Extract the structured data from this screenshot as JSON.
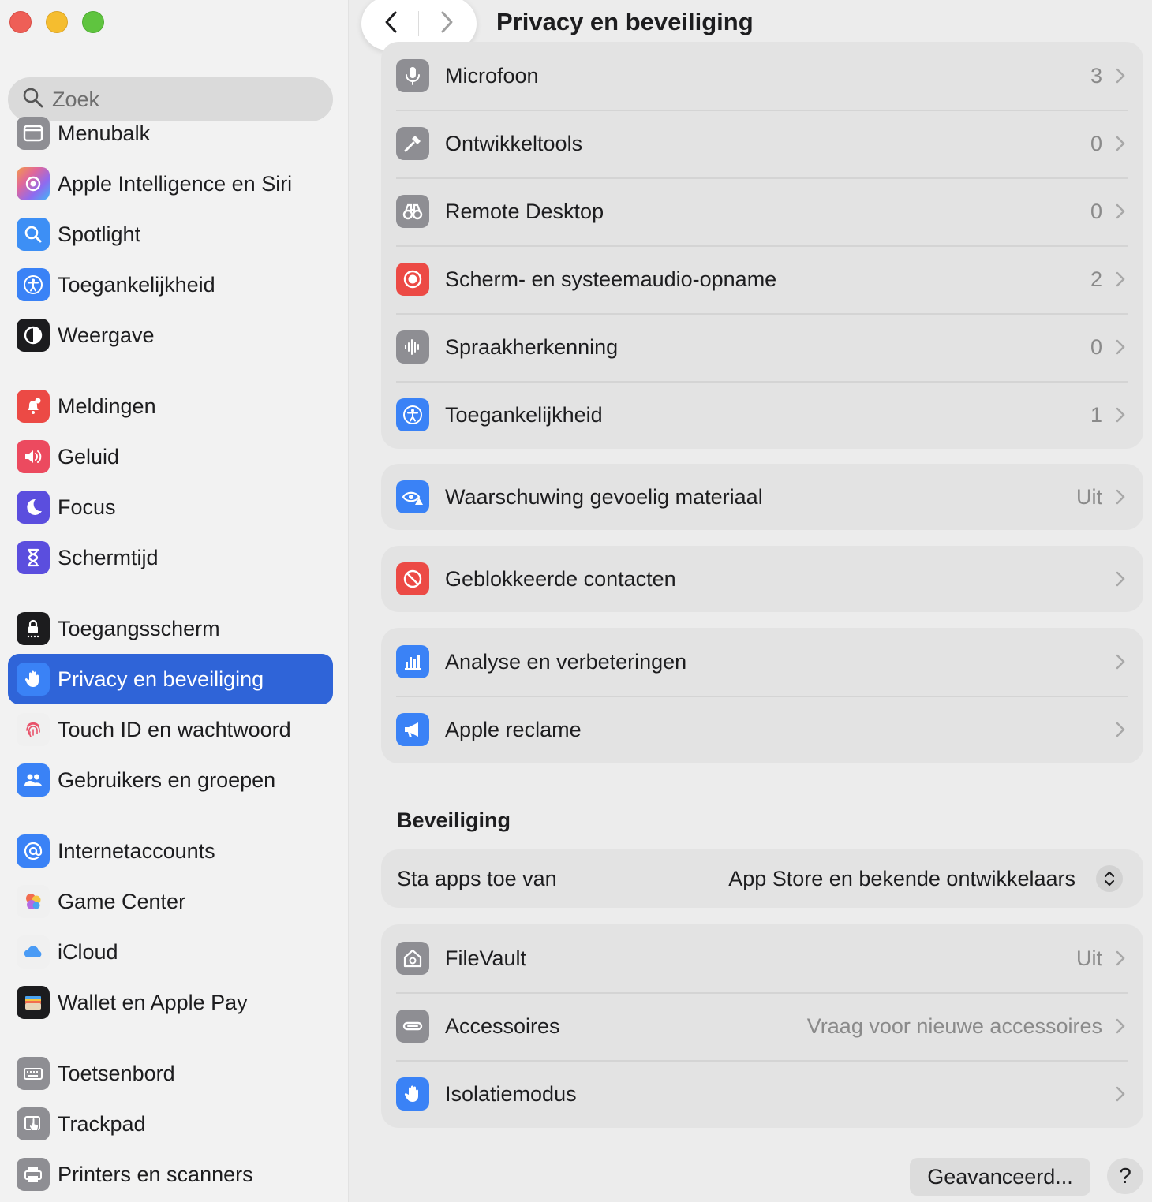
{
  "window": {
    "title": "Privacy en beveiliging"
  },
  "search": {
    "placeholder": "Zoek"
  },
  "sidebar": {
    "items": [
      {
        "label": "Menubalk",
        "icon": "menubar-icon",
        "color": "#8e8e93"
      },
      {
        "label": "Apple Intelligence en Siri",
        "icon": "siri-icon",
        "color": "#e0679a"
      },
      {
        "label": "Spotlight",
        "icon": "magnifier-icon",
        "color": "#3d8ff5"
      },
      {
        "label": "Toegankelijkheid",
        "icon": "accessibility-icon",
        "color": "#3a82f6"
      },
      {
        "label": "Weergave",
        "icon": "appearance-icon",
        "color": "#1c1c1e"
      },
      {
        "label": "Meldingen",
        "icon": "bell-icon",
        "color": "#ec4a45"
      },
      {
        "label": "Geluid",
        "icon": "speaker-icon",
        "color": "#ec4a5f"
      },
      {
        "label": "Focus",
        "icon": "moon-icon",
        "color": "#5b4ede"
      },
      {
        "label": "Schermtijd",
        "icon": "hourglass-icon",
        "color": "#5b4ede"
      },
      {
        "label": "Toegangsscherm",
        "icon": "lock-icon",
        "color": "#1c1c1e"
      },
      {
        "label": "Privacy en beveiliging",
        "icon": "hand-icon",
        "color": "#3a82f6"
      },
      {
        "label": "Touch ID en wachtwoord",
        "icon": "fingerprint-icon",
        "color": "#f0f0f0"
      },
      {
        "label": "Gebruikers en groepen",
        "icon": "users-icon",
        "color": "#3a82f6"
      },
      {
        "label": "Internetaccounts",
        "icon": "at-icon",
        "color": "#3a82f6"
      },
      {
        "label": "Game Center",
        "icon": "game-center-icon",
        "color": "#f0f0f0"
      },
      {
        "label": "iCloud",
        "icon": "cloud-icon",
        "color": "#f0f0f0"
      },
      {
        "label": "Wallet en Apple Pay",
        "icon": "wallet-icon",
        "color": "#1c1c1e"
      },
      {
        "label": "Toetsenbord",
        "icon": "keyboard-icon",
        "color": "#8e8e93"
      },
      {
        "label": "Trackpad",
        "icon": "trackpad-icon",
        "color": "#8e8e93"
      },
      {
        "label": "Printers en scanners",
        "icon": "printer-icon",
        "color": "#8e8e93"
      }
    ]
  },
  "privacy": {
    "rows": [
      {
        "label": "Microfoon",
        "value": "3",
        "icon": "microphone-icon"
      },
      {
        "label": "Ontwikkeltools",
        "value": "0",
        "icon": "hammer-icon"
      },
      {
        "label": "Remote Desktop",
        "value": "0",
        "icon": "binoculars-icon"
      },
      {
        "label": "Scherm- en systeemaudio-opname",
        "value": "2",
        "icon": "record-icon"
      },
      {
        "label": "Spraakherkenning",
        "value": "0",
        "icon": "waveform-icon"
      },
      {
        "label": "Toegankelijkheid",
        "value": "1",
        "icon": "accessibility-icon"
      }
    ]
  },
  "sensitive": {
    "label": "Waarschuwing gevoelig materiaal",
    "value": "Uit"
  },
  "blocked": {
    "label": "Geblokkeerde contacten"
  },
  "analytics": {
    "rows": [
      {
        "label": "Analyse en verbeteringen"
      },
      {
        "label": "Apple reclame"
      }
    ]
  },
  "security": {
    "heading": "Beveiliging",
    "allow_label": "Sta apps toe van",
    "allow_value": "App Store en bekende ontwikkelaars",
    "rows": [
      {
        "label": "FileVault",
        "value": "Uit"
      },
      {
        "label": "Accessoires",
        "value": "Vraag voor nieuwe accessoires"
      },
      {
        "label": "Isolatiemodus",
        "value": ""
      }
    ]
  },
  "footer": {
    "advanced_label": "Geavanceerd...",
    "help_label": "?"
  },
  "colors": {
    "accent": "#2f64d8",
    "selection_text": "#ffffff"
  }
}
